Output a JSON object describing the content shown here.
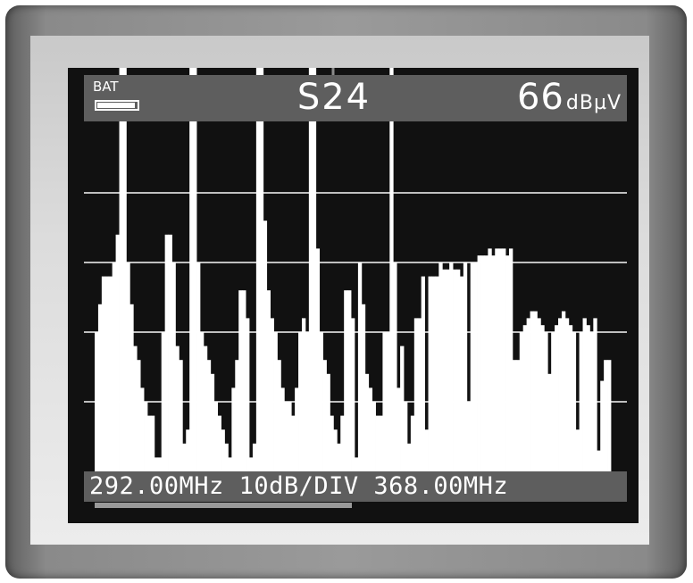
{
  "header": {
    "battery_label": "BAT",
    "battery_level": 0.95,
    "channel": "S24",
    "level_value": "66",
    "level_unit": "dBµV"
  },
  "footer": {
    "start_freq": "292.00MHz",
    "scale": "10dB/DIV",
    "stop_freq": "368.00MHz",
    "span_position": 0.48
  },
  "colors": {
    "screen_bg": "#111111",
    "header_bg": "#5e5e5e",
    "trace": "#ffffff",
    "grid": "#bfbfbf",
    "marker": "#8a8a8a"
  },
  "icons": {
    "battery": "battery-icon",
    "marker": "marker-line"
  },
  "chart_data": {
    "type": "area",
    "xlabel": "",
    "ylabel": "",
    "x_range": [
      292.0,
      368.0
    ],
    "x_unit": "MHz",
    "y_scale_per_div": 10,
    "grid": true,
    "marker_channel": "S24",
    "marker_level": 66,
    "levels": [
      20,
      24,
      28,
      28,
      28,
      30,
      34,
      78,
      78,
      30,
      24,
      18,
      16,
      12,
      10,
      8,
      8,
      2,
      2,
      20,
      34,
      34,
      30,
      18,
      16,
      4,
      6,
      76,
      76,
      30,
      20,
      18,
      16,
      14,
      10,
      8,
      6,
      4,
      2,
      12,
      16,
      26,
      26,
      22,
      2,
      4,
      78,
      78,
      36,
      26,
      22,
      20,
      16,
      12,
      10,
      10,
      8,
      12,
      20,
      22,
      20,
      76,
      76,
      32,
      20,
      16,
      14,
      8,
      6,
      4,
      8,
      26,
      26,
      22,
      2,
      30,
      24,
      14,
      12,
      10,
      8,
      8,
      20,
      20,
      76,
      30,
      12,
      18,
      10,
      4,
      8,
      22,
      22,
      28,
      6,
      28,
      28,
      28,
      30,
      29,
      29,
      30,
      29,
      29,
      28,
      30,
      10,
      30,
      30,
      31,
      31,
      31,
      32,
      31,
      32,
      32,
      32,
      31,
      32,
      16,
      16,
      20,
      21,
      22,
      23,
      23,
      22,
      21,
      20,
      14,
      20,
      21,
      22,
      23,
      22,
      21,
      20,
      6,
      20,
      22,
      21,
      20,
      22,
      3,
      13,
      16,
      16
    ]
  }
}
